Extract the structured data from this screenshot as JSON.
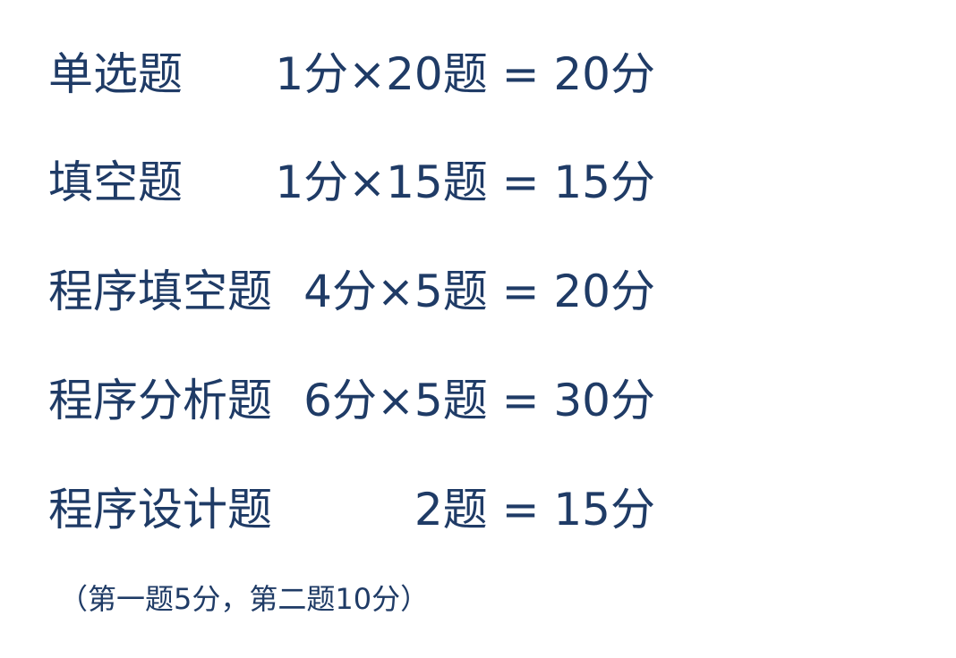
{
  "items": [
    {
      "label": "单选题",
      "formula": "1分×20题 = 20分"
    },
    {
      "label": "填空题",
      "formula": "1分×15题 = 15分"
    },
    {
      "label": "程序填空题",
      "formula": "4分×5题 = 20分"
    },
    {
      "label": "程序分析题",
      "formula": "6分×5题 = 30分"
    },
    {
      "label": "程序设计题",
      "formula": "2题 = 15分"
    }
  ],
  "note": "（第一题5分，第二题10分）"
}
